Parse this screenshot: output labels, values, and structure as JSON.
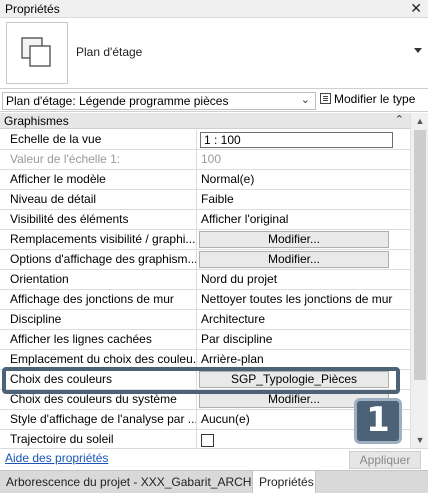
{
  "window": {
    "title": "Propriétés",
    "close_label": "✕"
  },
  "type_selector": {
    "thumbnail_icon": "floor-plan-icon",
    "name": "Plan d'étage"
  },
  "instance_selector": {
    "value": "Plan d'étage: Légende programme pièces",
    "edit_type_label": "Modifier le type"
  },
  "group": {
    "label": "Graphismes",
    "collapse_glyph": "⌃"
  },
  "properties": [
    {
      "name": "Echelle de la vue",
      "value": "1 : 100"
    },
    {
      "name": "Valeur de l'échelle    1:",
      "value": "100"
    },
    {
      "name": "Afficher le modèle",
      "value": "Normal(e)"
    },
    {
      "name": "Niveau de détail",
      "value": "Faible"
    },
    {
      "name": "Visibilité des éléments",
      "value": "Afficher l'original"
    },
    {
      "name": "Remplacements visibilité / graphi...",
      "value": "Modifier..."
    },
    {
      "name": "Options d'affichage des graphism...",
      "value": "Modifier..."
    },
    {
      "name": "Orientation",
      "value": "Nord du projet"
    },
    {
      "name": "Affichage des jonctions de mur",
      "value": "Nettoyer toutes les jonctions de mur"
    },
    {
      "name": "Discipline",
      "value": "Architecture"
    },
    {
      "name": "Afficher les lignes cachées",
      "value": "Par discipline"
    },
    {
      "name": "Emplacement du choix des couleu...",
      "value": "Arrière-plan"
    },
    {
      "name": "Choix des couleurs",
      "value": "SGP_Typologie_Pièces"
    },
    {
      "name": "Choix des couleurs du système",
      "value": "Modifier..."
    },
    {
      "name": "Style d'affichage de l'analyse par ...",
      "value": "Aucun(e)"
    },
    {
      "name": "Trajectoire du soleil",
      "value": false
    }
  ],
  "callout": {
    "number": "1",
    "color": "#4b6277"
  },
  "footer": {
    "help_link": "Aide des propriétés",
    "apply_label": "Appliquer"
  },
  "tabs": [
    {
      "label": "Arborescence du projet - XXX_Gabarit_ARCHI"
    },
    {
      "label": "Propriétés"
    }
  ],
  "colors": {
    "highlight_frame": "#4b6277",
    "link": "#1a55b5"
  }
}
